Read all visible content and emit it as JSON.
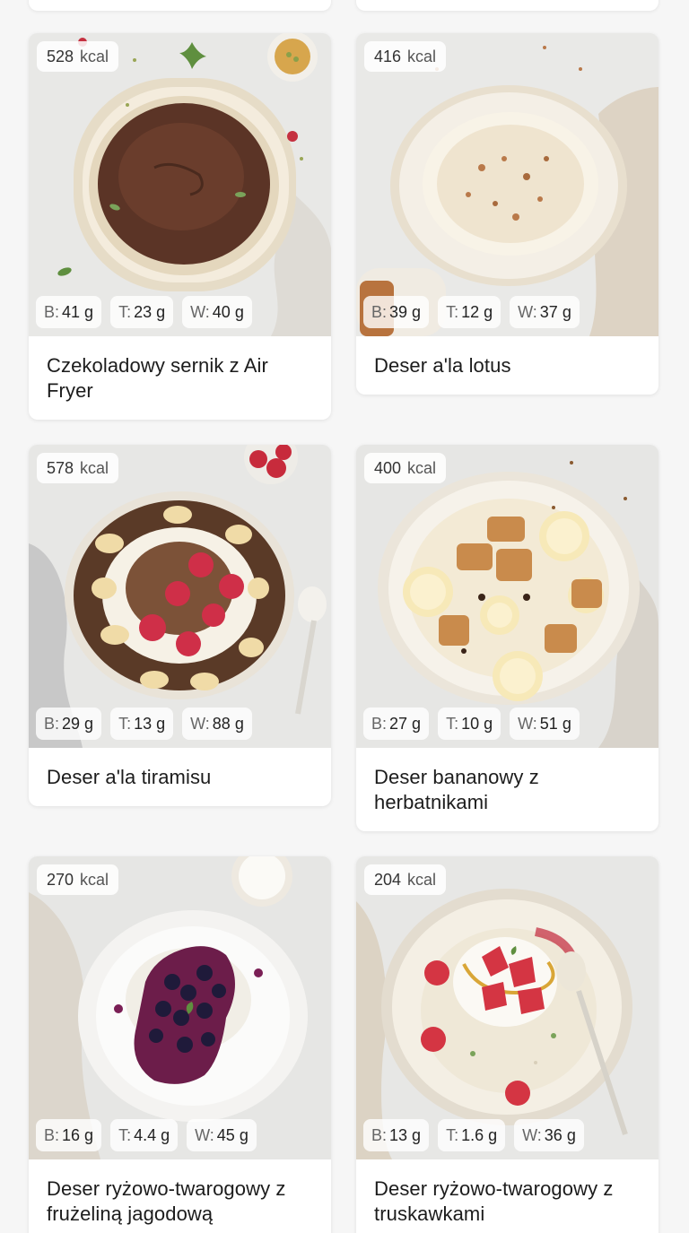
{
  "recipes": [
    {
      "kcal": "528",
      "kcal_unit": "kcal",
      "protein_label": "B:",
      "protein": "41 g",
      "fat_label": "T:",
      "fat": "23 g",
      "carbs_label": "W:",
      "carbs": "40 g",
      "title": "Czekoladowy sernik z Air Fryer"
    },
    {
      "kcal": "416",
      "kcal_unit": "kcal",
      "protein_label": "B:",
      "protein": "39 g",
      "fat_label": "T:",
      "fat": "12 g",
      "carbs_label": "W:",
      "carbs": "37 g",
      "title": "Deser a'la lotus"
    },
    {
      "kcal": "578",
      "kcal_unit": "kcal",
      "protein_label": "B:",
      "protein": "29 g",
      "fat_label": "T:",
      "fat": "13 g",
      "carbs_label": "W:",
      "carbs": "88 g",
      "title": "Deser a'la tiramisu"
    },
    {
      "kcal": "400",
      "kcal_unit": "kcal",
      "protein_label": "B:",
      "protein": "27 g",
      "fat_label": "T:",
      "fat": "10 g",
      "carbs_label": "W:",
      "carbs": "51 g",
      "title": "Deser bananowy z herbatnikami"
    },
    {
      "kcal": "270",
      "kcal_unit": "kcal",
      "protein_label": "B:",
      "protein": "16 g",
      "fat_label": "T:",
      "fat": "4.4 g",
      "carbs_label": "W:",
      "carbs": "45 g",
      "title": "Deser ryżowo-twarogowy z frużeliną jagodową"
    },
    {
      "kcal": "204",
      "kcal_unit": "kcal",
      "protein_label": "B:",
      "protein": "13 g",
      "fat_label": "T:",
      "fat": "1.6 g",
      "carbs_label": "W:",
      "carbs": "36 g",
      "title": "Deser ryżowo-twarogowy z truskawkami"
    }
  ],
  "colors": {
    "page_background": "#f6f6f6",
    "card_background": "#ffffff",
    "photo_background": "#e6e6e4"
  }
}
